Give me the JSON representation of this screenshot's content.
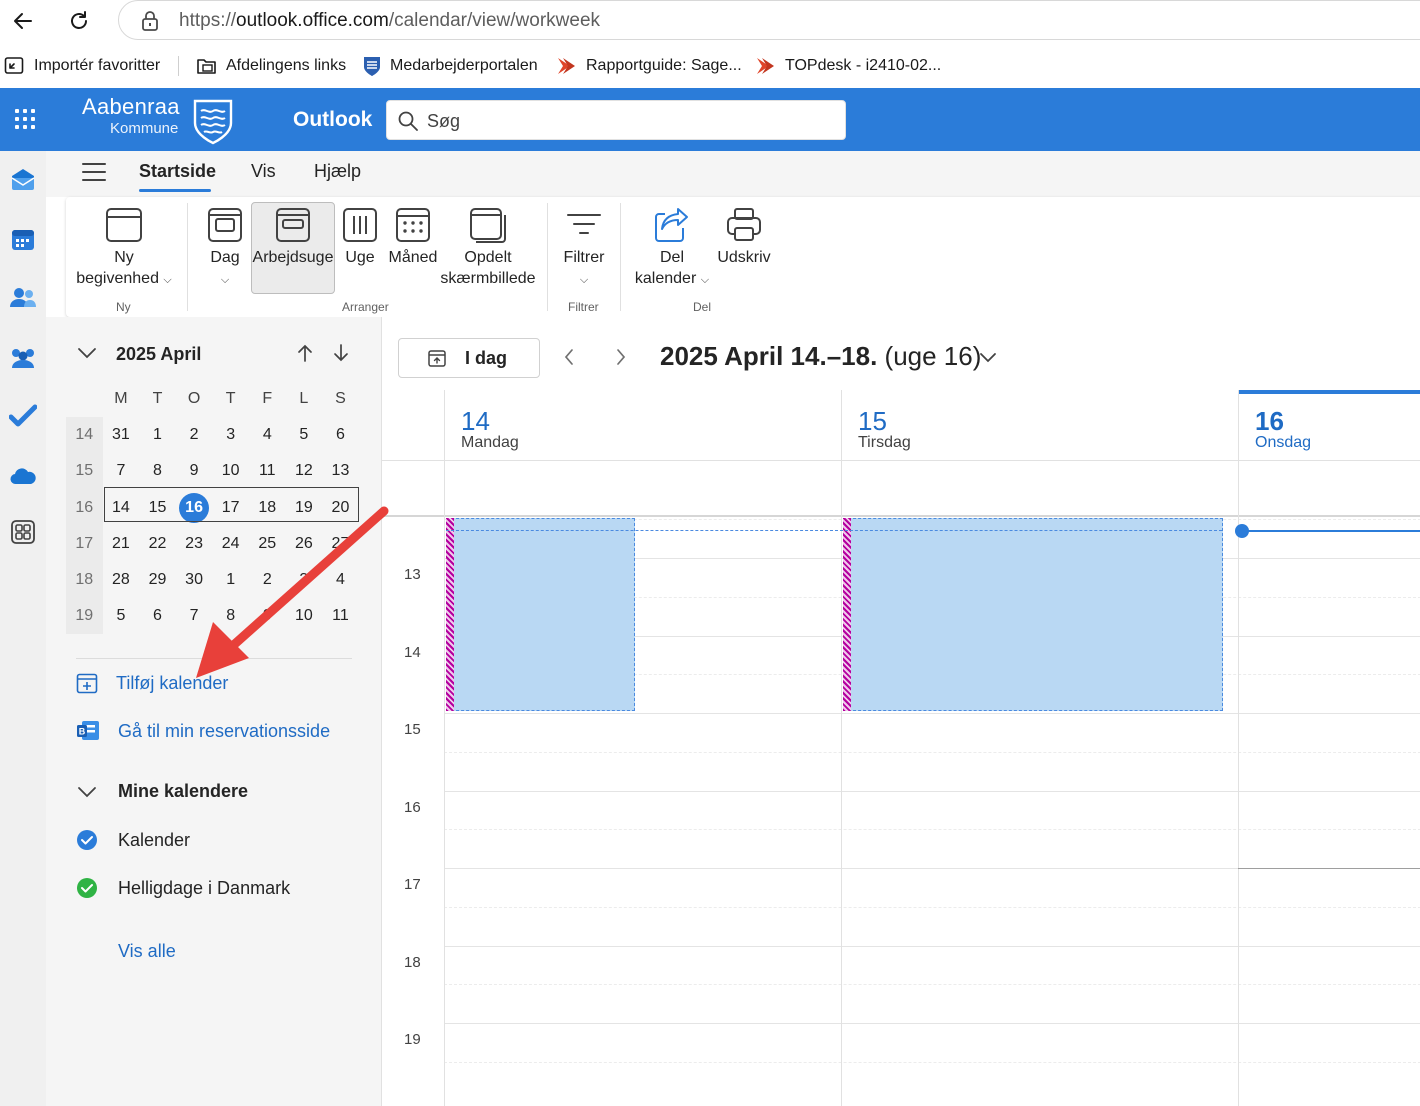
{
  "browser": {
    "url_scheme": "https://",
    "url_host": "outlook.office.com",
    "url_path": "/calendar/view/workweek",
    "favorites": [
      {
        "label": "Importér favoritter",
        "icon": "import-icon"
      },
      {
        "label": "Afdelingens links",
        "icon": "folder-icon"
      },
      {
        "label": "Medarbejderportalen",
        "icon": "shield-icon"
      },
      {
        "label": "Rapportguide: Sage...",
        "icon": "arrow-favicon-icon"
      },
      {
        "label": "TOPdesk - i2410-02...",
        "icon": "arrow-favicon-icon"
      }
    ]
  },
  "header": {
    "org_name_line1": "Aabenraa",
    "org_name_line2": "Kommune",
    "app_name": "Outlook",
    "search_placeholder": "Søg",
    "brand_color": "#2b7cd9"
  },
  "rail": [
    "mail-icon",
    "calendar-icon",
    "people-icon",
    "groups-icon",
    "todo-icon",
    "onedrive-icon",
    "apps-icon"
  ],
  "ribbon": {
    "tabs": [
      "Startside",
      "Vis",
      "Hjælp"
    ],
    "active_tab": "Startside",
    "buttons": {
      "new_event_1": "Ny",
      "new_event_2": "begivenhed",
      "day": "Dag",
      "workweek": "Arbejdsuge",
      "week": "Uge",
      "month": "Måned",
      "split_1": "Opdelt",
      "split_2": "skærmbillede",
      "filter": "Filtrer",
      "share_1": "Del",
      "share_2": "kalender",
      "print": "Udskriv"
    },
    "groups": {
      "new": "Ny",
      "arrange": "Arranger",
      "filter": "Filtrer",
      "share": "Del"
    },
    "selected_view": "Arbejdsuge"
  },
  "mini_calendar": {
    "title": "2025 April",
    "weekdays": [
      "M",
      "T",
      "O",
      "T",
      "F",
      "L",
      "S"
    ],
    "weeks": [
      {
        "wk": "14",
        "days": [
          "31",
          "1",
          "2",
          "3",
          "4",
          "5",
          "6"
        ]
      },
      {
        "wk": "15",
        "days": [
          "7",
          "8",
          "9",
          "10",
          "11",
          "12",
          "13"
        ]
      },
      {
        "wk": "16",
        "days": [
          "14",
          "15",
          "16",
          "17",
          "18",
          "19",
          "20"
        ]
      },
      {
        "wk": "17",
        "days": [
          "21",
          "22",
          "23",
          "24",
          "25",
          "26",
          "27"
        ]
      },
      {
        "wk": "18",
        "days": [
          "28",
          "29",
          "30",
          "1",
          "2",
          "3",
          "4"
        ]
      },
      {
        "wk": "19",
        "days": [
          "5",
          "6",
          "7",
          "8",
          "9",
          "10",
          "11"
        ]
      }
    ],
    "today": "16",
    "selected_week": "16"
  },
  "left_pane": {
    "add_calendar": "Tilføj kalender",
    "booking_page": "Gå til min reservationsside",
    "my_calendars": "Mine kalendere",
    "calendars": [
      {
        "name": "Kalender",
        "color": "#2b7cd9"
      },
      {
        "name": "Helligdage i Danmark",
        "color": "#2fb344"
      }
    ],
    "show_all": "Vis alle"
  },
  "calendar": {
    "today_button": "I dag",
    "range_bold": "2025 April 14.–18.",
    "range_week": "(uge 16)",
    "days": [
      {
        "num": "14",
        "name": "Mandag"
      },
      {
        "num": "15",
        "name": "Tirsdag"
      },
      {
        "num": "16",
        "name": "Onsdag"
      }
    ],
    "current_day": "16",
    "hours": [
      "13",
      "14",
      "15",
      "16",
      "17",
      "18",
      "19"
    ],
    "event_color": "#b9d8f3",
    "event_stripe_color": "#b4009e"
  }
}
